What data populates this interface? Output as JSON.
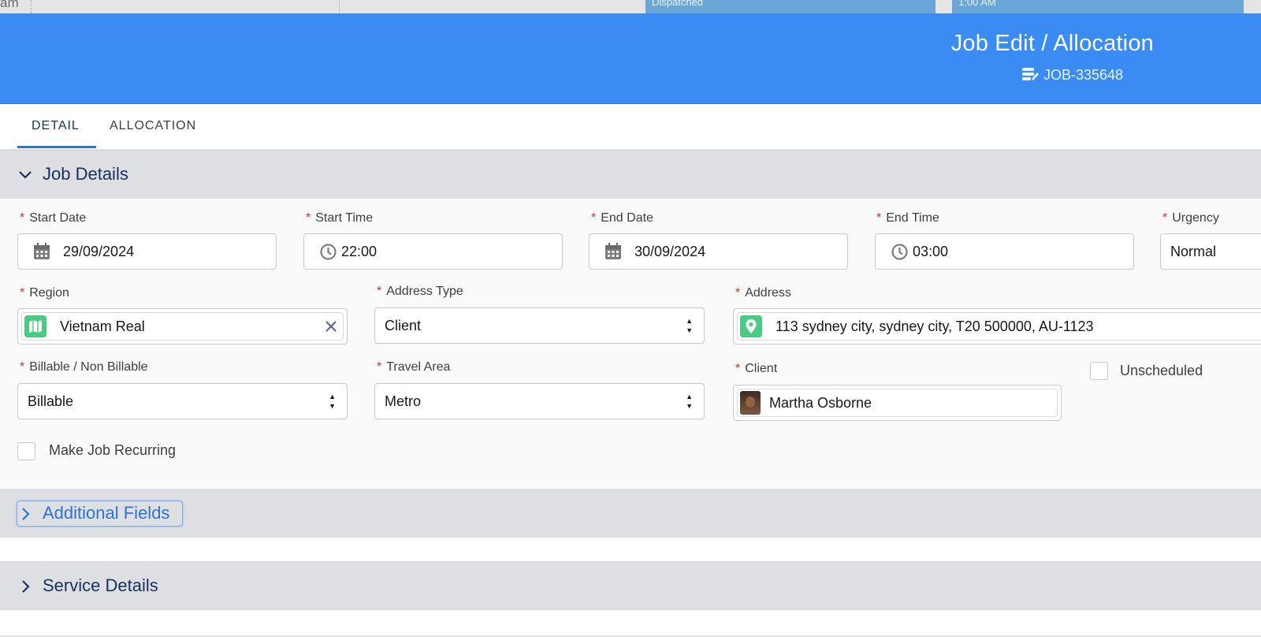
{
  "background": {
    "left_fragment": "am",
    "block1_text": "Dispatched",
    "block2_text": "1:00 AM"
  },
  "header": {
    "title": "Job Edit / Allocation",
    "job_id": "JOB-335648"
  },
  "tabs": [
    {
      "label": "DETAIL",
      "active": true
    },
    {
      "label": "ALLOCATION",
      "active": false
    }
  ],
  "sections": {
    "job_details": "Job Details",
    "additional_fields": "Additional Fields",
    "service_details": "Service Details"
  },
  "fields": {
    "start_date": {
      "label": "Start Date",
      "value": "29/09/2024"
    },
    "start_time": {
      "label": "Start Time",
      "value": "22:00"
    },
    "end_date": {
      "label": "End Date",
      "value": "30/09/2024"
    },
    "end_time": {
      "label": "End Time",
      "value": "03:00"
    },
    "urgency": {
      "label": "Urgency",
      "value": "Normal"
    },
    "region": {
      "label": "Region",
      "value": "Vietnam Real"
    },
    "address_type": {
      "label": "Address Type",
      "value": "Client"
    },
    "address": {
      "label": "Address",
      "value": "113 sydney city, sydney city, T20 500000, AU-1123"
    },
    "billable": {
      "label": "Billable / Non Billable",
      "value": "Billable"
    },
    "travel_area": {
      "label": "Travel Area",
      "value": "Metro"
    },
    "client": {
      "label": "Client",
      "value": "Martha Osborne"
    },
    "unscheduled": {
      "label": "Unscheduled",
      "checked": false
    },
    "make_recurring": {
      "label": "Make Job Recurring",
      "checked": false
    }
  },
  "required_marker": "*",
  "colors": {
    "header_blue": "#3b8bf5",
    "required_red": "#c23934",
    "lookup_green": "#4bca81",
    "section_gray": "#dddfe3"
  }
}
